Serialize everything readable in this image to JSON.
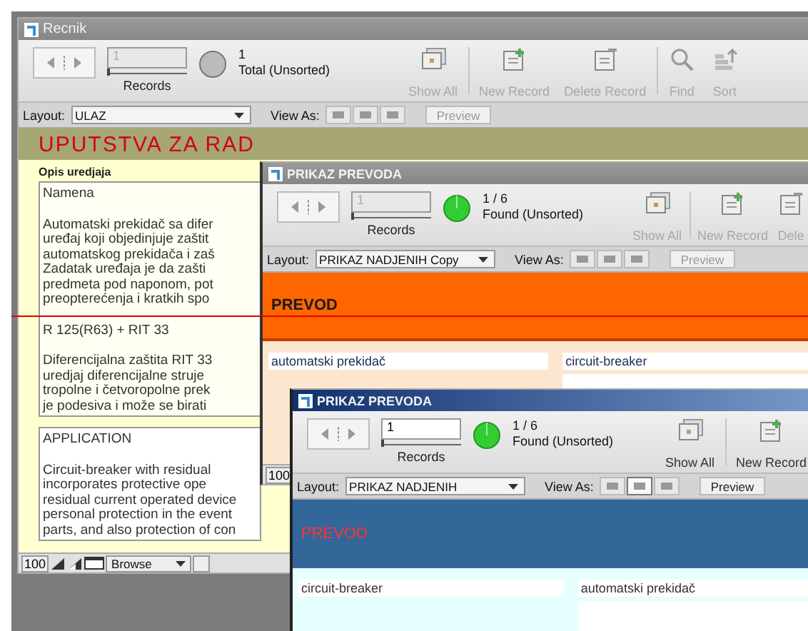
{
  "windows": [
    {
      "title": "Recnik",
      "active": false,
      "record": "1",
      "slider": {
        "level": 0
      },
      "records_label": "Records",
      "indicator": {
        "kind": "total"
      },
      "count": "1",
      "count_label": "Total (Unsorted)",
      "tools": [
        {
          "label": "Show All",
          "kind": "stack",
          "disabled": true
        },
        {
          "label": "New Record",
          "kind": "new",
          "disabled": true
        },
        {
          "label": "Delete Record",
          "kind": "delete",
          "disabled": true
        },
        {
          "label": "Find",
          "kind": "search",
          "disabled": true
        },
        {
          "label": "Sort",
          "kind": "sort",
          "disabled": true
        }
      ],
      "layout_label": "Layout:",
      "layout": "ULAZ",
      "view_label": "View As:",
      "views": [
        {
          "selected": false
        },
        {
          "selected": false
        },
        {
          "selected": false
        }
      ],
      "preview": "Preview",
      "preview_disabled": true,
      "header": {
        "text": "UPUTSTVA ZA RAD",
        "kind": "olive"
      },
      "section_label": "Opis uredjaja",
      "text_boxes": [
        {
          "paragraphs": [
            [
              "Namena"
            ],
            [
              "Automatski prekidač sa difer",
              "uređaj koji objedinjuje zaštit",
              "automatskog prekidača i zaš",
              "Zadatak uređaja je da zašti",
              "predmeta pod naponom, pot",
              "preopterećenja i kratkih spo"
            ],
            [
              "R 125(R63) + RIT 33"
            ],
            [
              "Diferencijalna zaštita RIT 33",
              "uredjaj diferencijalne  struje",
              "tropolne i  četvoropolne prek",
              "je podesiva i može se birati"
            ]
          ]
        },
        {
          "paragraphs": [
            [
              "APPLICATION"
            ],
            [
              "Circuit-breaker with residual",
              "incorporates protective ope",
              "residual current operated device",
              "personal protection in the event",
              "parts, and also protection of con"
            ]
          ]
        }
      ],
      "status": {
        "zoom": "100",
        "mode": "Browse"
      }
    },
    {
      "title": "PRIKAZ PREVODA",
      "active": false,
      "record": "1",
      "slider": {
        "level": 0
      },
      "records_label": "Records",
      "indicator": {
        "kind": "found"
      },
      "count": "1 / 6",
      "count_label": "Found (Unsorted)",
      "tools": [
        {
          "label": "Show All",
          "kind": "stack",
          "disabled": true
        },
        {
          "label": "New Record",
          "kind": "new",
          "disabled": true
        },
        {
          "label": "Dele",
          "kind": "delete",
          "disabled": true
        }
      ],
      "layout_label": "Layout:",
      "layout": "PRIKAZ NADJENIH Copy",
      "view_label": "View As:",
      "views": [
        {
          "selected": false
        },
        {
          "selected": false
        },
        {
          "selected": false
        }
      ],
      "preview": "Preview",
      "preview_disabled": true,
      "header": {
        "text": "PREVOD",
        "kind": "orange"
      },
      "fields": [
        {
          "value": "automatski prekidač"
        },
        {
          "value": "circuit-breaker"
        }
      ],
      "status": {
        "zoom": "100"
      }
    },
    {
      "title": "PRIKAZ PREVODA",
      "active": true,
      "record": "1",
      "slider": {
        "level": 0
      },
      "records_label": "Records",
      "indicator": {
        "kind": "found"
      },
      "count": "1 / 6",
      "count_label": "Found (Unsorted)",
      "tools": [
        {
          "label": "Show All",
          "kind": "stack",
          "disabled": false
        },
        {
          "label": "New Record",
          "kind": "new",
          "disabled": false
        }
      ],
      "layout_label": "Layout:",
      "layout": "PRIKAZ NADJENIH",
      "view_label": "View As:",
      "views": [
        {
          "selected": false
        },
        {
          "selected": true
        },
        {
          "selected": false
        }
      ],
      "preview": "Preview",
      "preview_disabled": false,
      "header": {
        "text": "PREVOD",
        "kind": "blue"
      },
      "fields": [
        {
          "value": "circuit-breaker"
        },
        {
          "value": "automatski prekidač"
        }
      ]
    }
  ]
}
